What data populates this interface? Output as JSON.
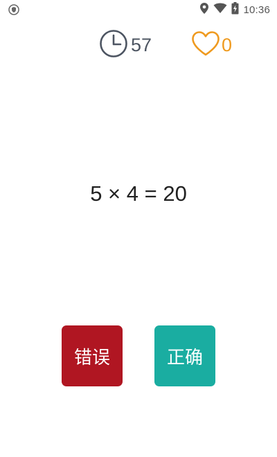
{
  "status_bar": {
    "time": "10:36",
    "icons": [
      "shield-icon",
      "location-icon",
      "wifi-icon",
      "battery-icon"
    ]
  },
  "hud": {
    "timer_value": "57",
    "lives_value": "0"
  },
  "question": {
    "equation": "5 × 4 = 20"
  },
  "buttons": {
    "wrong_label": "错误",
    "right_label": "正确"
  },
  "colors": {
    "wrong": "#b01622",
    "right": "#1aada1",
    "heart": "#ef9a1f",
    "clock": "#4d5562"
  }
}
